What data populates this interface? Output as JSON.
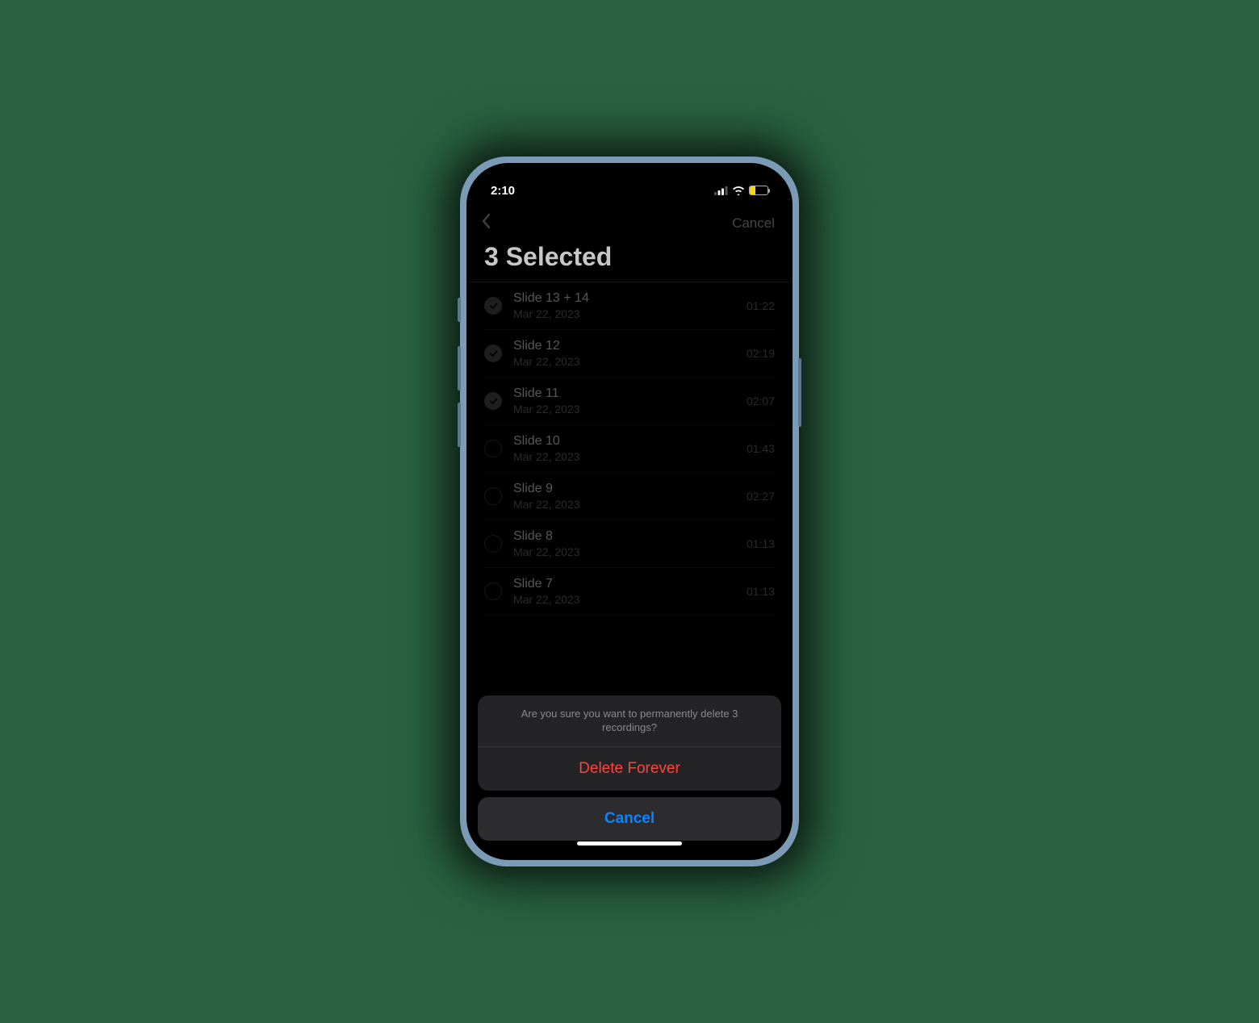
{
  "statusBar": {
    "time": "2:10"
  },
  "nav": {
    "cancel": "Cancel"
  },
  "title": "3 Selected",
  "recordings": [
    {
      "title": "Slide 13 + 14",
      "date": "Mar 22, 2023",
      "duration": "01:22",
      "selected": true
    },
    {
      "title": "Slide 12",
      "date": "Mar 22, 2023",
      "duration": "02:19",
      "selected": true
    },
    {
      "title": "Slide 11",
      "date": "Mar 22, 2023",
      "duration": "02:07",
      "selected": true
    },
    {
      "title": "Slide 10",
      "date": "Mar 22, 2023",
      "duration": "01:43",
      "selected": false
    },
    {
      "title": "Slide 9",
      "date": "Mar 22, 2023",
      "duration": "02:27",
      "selected": false
    },
    {
      "title": "Slide 8",
      "date": "Mar 22, 2023",
      "duration": "01:13",
      "selected": false
    },
    {
      "title": "Slide 7",
      "date": "Mar 22, 2023",
      "duration": "01:13",
      "selected": false
    }
  ],
  "actionSheet": {
    "message": "Are you sure you want to permanently delete 3 recordings?",
    "destructiveLabel": "Delete Forever",
    "cancelLabel": "Cancel"
  },
  "colors": {
    "destructive": "#ff453a",
    "accent": "#0a84ff",
    "batteryFill": "#ffd60a"
  }
}
